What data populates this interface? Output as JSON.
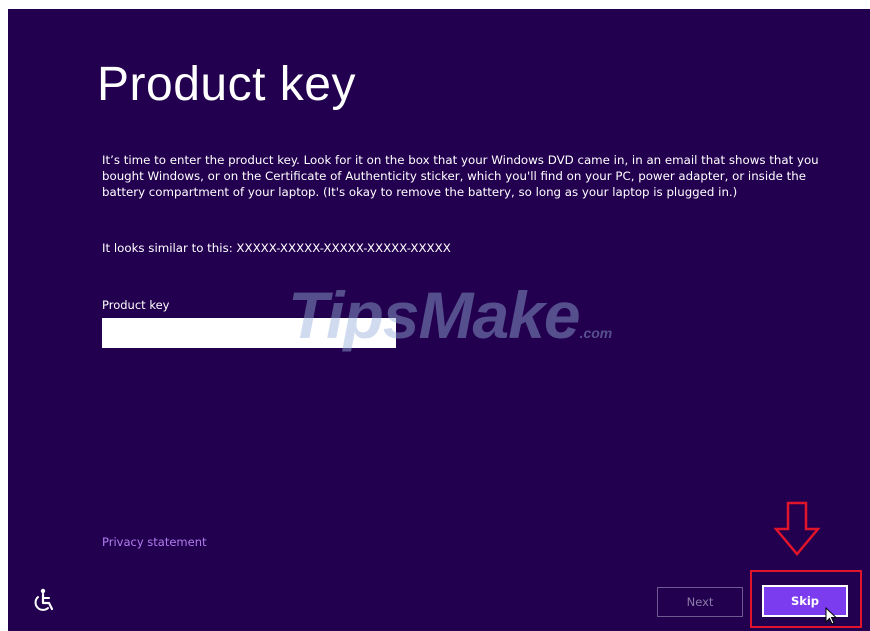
{
  "page": {
    "title": "Product key",
    "description": "It’s time to enter the product key. Look for it on the box that your Windows DVD came in, in an email that shows that you bought Windows, or on the Certificate of Authenticity sticker, which you'll find on your PC, power adapter, or inside the battery compartment of your laptop. (It's okay to remove the battery, so long as your laptop is plugged in.)",
    "example_text": "It looks similar to this: XXXXX-XXXXX-XXXXX-XXXXX-XXXXX"
  },
  "form": {
    "product_key_label": "Product key",
    "product_key_value": "",
    "product_key_placeholder": ""
  },
  "footer": {
    "privacy_link": "Privacy statement",
    "next_label": "Next",
    "skip_label": "Skip",
    "ease_of_access_icon": "ease-of-access-icon"
  },
  "annotations": {
    "arrow_icon": "down-arrow-icon",
    "highlight_color": "#e0142a"
  },
  "watermark": {
    "brand_main": "TipsMake",
    "brand_suffix": ".com"
  },
  "colors": {
    "background": "#22004f",
    "accent": "#7b3cf0",
    "link": "#b07cf0"
  }
}
